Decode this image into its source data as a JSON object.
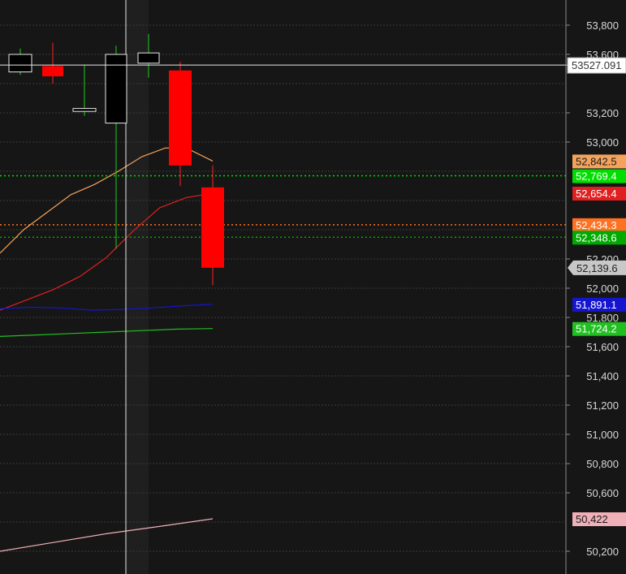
{
  "chart_data": {
    "type": "candlestick",
    "ylim": [
      50100,
      53900
    ],
    "yticks": [
      "53,800",
      "53,600",
      "53,200",
      "53,000",
      "52,200",
      "52,000",
      "51,800",
      "51,600",
      "51,400",
      "51,200",
      "51,000",
      "50,800",
      "50,600",
      "50,200"
    ],
    "ytick_values": [
      53800,
      53600,
      53200,
      53000,
      52200,
      52000,
      51800,
      51600,
      51400,
      51200,
      51000,
      50800,
      50600,
      50200
    ],
    "grid": true,
    "crosshair": {
      "price": 53527.09,
      "label": "53527.091"
    },
    "candles": [
      {
        "open": 53480,
        "close": 53600,
        "high": 53640,
        "low": 53460
      },
      {
        "open": 53520,
        "close": 53450,
        "high": 53680,
        "low": 53400
      },
      {
        "open": 53210,
        "close": 53230,
        "high": 53530,
        "low": 53180
      },
      {
        "open": 53130,
        "close": 53600,
        "high": 53660,
        "low": 52270
      },
      {
        "open": 53540,
        "close": 53610,
        "high": 53740,
        "low": 53440
      },
      {
        "open": 53490,
        "close": 52840,
        "high": 53550,
        "low": 52700
      },
      {
        "open": 52690,
        "close": 52140,
        "high": 52840,
        "low": 52020
      }
    ],
    "levels": [
      {
        "value": 52769.4,
        "label": "52,769.4",
        "color": "#00dd00",
        "style": "dotted"
      },
      {
        "value": 52434.3,
        "label": "52,434.3",
        "color": "#ff7020",
        "style": "dotted"
      },
      {
        "value": 52348.6,
        "label": "52,348.6",
        "color": "#00aa00",
        "style": "dotted"
      }
    ],
    "series": [
      {
        "color": "#f4a35c",
        "label": "52,842.5",
        "points": [
          52240,
          52400,
          52520,
          52640,
          52710,
          52800,
          52900,
          52960,
          52950,
          52870
        ]
      },
      {
        "color": "#e02020",
        "label": "52,654.4",
        "points": [
          51850,
          51920,
          51990,
          52080,
          52210,
          52390,
          52550,
          52620,
          52650
        ]
      },
      {
        "color": "#1515d0",
        "label": "51,891.1",
        "points": [
          51860,
          51870,
          51865,
          51850,
          51855,
          51865,
          51880,
          51890
        ]
      },
      {
        "color": "#20c020",
        "label": "51,724.2",
        "points": [
          51670,
          51680,
          51690,
          51700,
          51710,
          51720,
          51724
        ]
      },
      {
        "color": "#f0b0b8",
        "label": "50,422",
        "points": [
          50200,
          50260,
          50320,
          50370,
          50422
        ]
      }
    ],
    "price_tag": {
      "value": 52139.6,
      "label": "52,139.6",
      "color": "#c8c8c8"
    }
  }
}
